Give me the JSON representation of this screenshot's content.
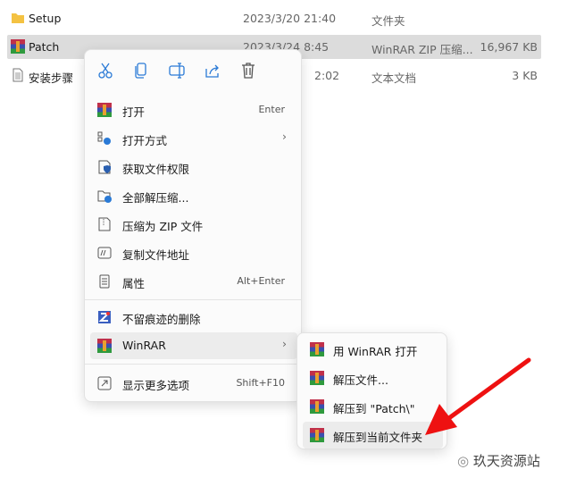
{
  "files": [
    {
      "name": "Setup",
      "date": "2023/3/20 21:40",
      "type": "文件夹",
      "size": "",
      "icon": "folder-icon"
    },
    {
      "name": "Patch",
      "date": "2023/3/24 8:45",
      "type": "WinRAR ZIP 压缩...",
      "size": "16,967 KB",
      "icon": "winrar-icon",
      "selected": true
    },
    {
      "name": "安装步骤",
      "date": "2:02",
      "type": "文本文档",
      "size": "3 KB",
      "icon": "text-file-icon"
    }
  ],
  "toolbar": [
    "cut",
    "copy",
    "rename",
    "share",
    "delete"
  ],
  "menu": {
    "items": [
      {
        "label": "打开",
        "shortcut": "Enter"
      },
      {
        "label": "打开方式",
        "shortcut": ""
      },
      {
        "label": "获取文件权限",
        "shortcut": ""
      },
      {
        "label": "全部解压缩...",
        "shortcut": ""
      },
      {
        "label": "压缩为 ZIP 文件",
        "shortcut": ""
      },
      {
        "label": "复制文件地址",
        "shortcut": ""
      },
      {
        "label": "属性",
        "shortcut": "Alt+Enter"
      },
      {
        "label": "不留痕迹的删除",
        "shortcut": ""
      },
      {
        "label": "WinRAR",
        "shortcut": ""
      },
      {
        "label": "显示更多选项",
        "shortcut": "Shift+F10"
      }
    ]
  },
  "submenu": {
    "items": [
      {
        "label": "用 WinRAR 打开"
      },
      {
        "label": "解压文件..."
      },
      {
        "label": "解压到 \"Patch\\\""
      },
      {
        "label": "解压到当前文件夹"
      }
    ]
  },
  "watermark": "玖天资源站",
  "colors": {
    "arrow": "#ee1111",
    "accent": "#2a7ad6"
  }
}
